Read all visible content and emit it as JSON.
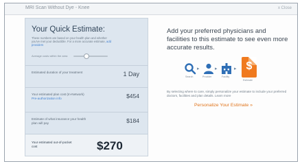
{
  "window": {
    "title": "MRI Scan Without Dye - Knee",
    "close_label": "x Close"
  },
  "estimate": {
    "title": "Your Quick Estimate:",
    "intro_text": "These numbers are based on your health plan and whether you've met your deductible. For a more accurate estimate,",
    "intro_link": "add providers",
    "slider_label": "Average costs within the area",
    "slider_position": 0.35,
    "rows": [
      {
        "label": "Estimated duration of your treatment",
        "value": "1 Day",
        "link": ""
      },
      {
        "label": "Your estimated plan cost (In-Network)",
        "value": "$454",
        "link": "Pre-authorization info"
      },
      {
        "label": "Estimate of what insurance your health plan will pay",
        "value": "$184",
        "link": ""
      }
    ],
    "total_label": "Your estimated out-of-pocket cost",
    "total_value": "$270"
  },
  "right": {
    "heading": "Add your preferred physicians and facilities to this estimate to see even more accurate results.",
    "icon_captions": [
      "Search",
      "Provider",
      "Facility"
    ],
    "doc_caption": "Estimate",
    "small_text": "By selecting where to care, simply personalize your estimate to include your preferred doctors, facilities and plan details. Learn more",
    "personalize_label": "Personalize Your Estimate »"
  },
  "colors": {
    "panel_bg": "#dde6ef",
    "accent_orange": "#f07a1f",
    "link_blue": "#3f7fcf"
  }
}
